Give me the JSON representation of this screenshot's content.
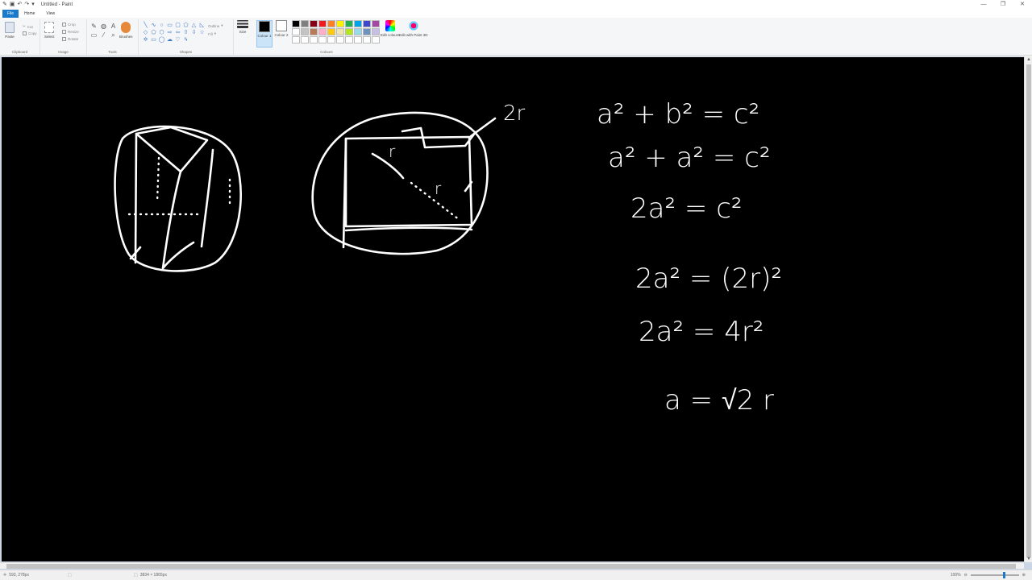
{
  "window": {
    "title": "Untitled - Paint",
    "controls": [
      "minimize",
      "maximize",
      "close"
    ]
  },
  "menu": {
    "file": "File",
    "tabs": [
      "Home",
      "View"
    ]
  },
  "ribbon": {
    "clipboard": {
      "label": "Clipboard",
      "paste": "Paste",
      "cut": "Cut",
      "copy": "Copy"
    },
    "image": {
      "label": "Image",
      "select": "Select",
      "crop": "Crop",
      "resize": "Resize",
      "rotate": "Rotate"
    },
    "tools": {
      "label": "Tools",
      "brushes": "Brushes"
    },
    "shapes": {
      "label": "Shapes",
      "outline": "Outline",
      "fill": "Fill"
    },
    "size": "Size",
    "colour1": "Colour 1",
    "colour2": "Colour 2",
    "colours": {
      "label": "Colours",
      "edit": "Edit colours"
    },
    "paint3d": "Edit with Paint 3D",
    "palette": [
      "#000000",
      "#7f7f7f",
      "#880015",
      "#ed1c24",
      "#ff7f27",
      "#fff200",
      "#22b14c",
      "#00a2e8",
      "#3f48cc",
      "#a349a4",
      "#ffffff",
      "#c3c3c3",
      "#b97a57",
      "#ffaec9",
      "#ffc90e",
      "#efe4b0",
      "#b5e61d",
      "#99d9ea",
      "#7092be",
      "#c8bfe7",
      "#ffffff",
      "#ffffff",
      "#ffffff",
      "#ffffff",
      "#ffffff",
      "#ffffff",
      "#ffffff",
      "#ffffff",
      "#ffffff",
      "#ffffff"
    ],
    "colour1_value": "#000000",
    "colour2_value": "#ffffff"
  },
  "canvas": {
    "background": "#000000",
    "ink": "#ffffff",
    "annotations": {
      "diameter_label": "2r",
      "radius_label_1": "r",
      "radius_label_2": "r",
      "eq1": "a² + b² = c²",
      "eq2": "a² + a² = c²",
      "eq3": "2a² = c²",
      "eq4": "2a² = (2r)²",
      "eq5": "2a² = 4r²",
      "eq6": "a = √2 r"
    }
  },
  "status": {
    "cursor": "593, 278px",
    "dimensions": "3834 × 1865px",
    "zoom": "100%"
  }
}
